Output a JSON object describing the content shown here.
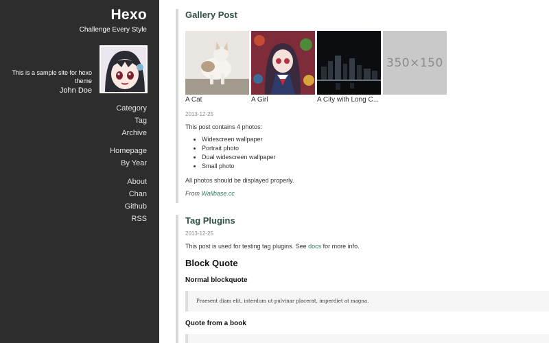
{
  "site": {
    "title": "Hexo",
    "subtitle": "Challenge Every Style",
    "description": "This is a sample site for hexo theme",
    "author": "John Doe"
  },
  "nav": {
    "group1": [
      "Category",
      "Tag",
      "Archive"
    ],
    "group2": [
      "Homepage",
      "By Year"
    ],
    "group3": [
      "About",
      "Chan",
      "Github",
      "RSS"
    ]
  },
  "posts": {
    "gallery": {
      "title": "Gallery Post",
      "images": [
        {
          "caption": "A Cat",
          "icon": "cat-photo"
        },
        {
          "caption": "A Girl",
          "icon": "anime-girl-photo"
        },
        {
          "caption": "A City with Long C...",
          "icon": "city-night-photo"
        },
        {
          "caption": "",
          "icon": "placeholder",
          "placeholder_text": "350×150"
        }
      ],
      "date": "2013-12-25",
      "intro": "This post contains 4 photos:",
      "list": [
        "Widescreen wallpaper",
        "Portrait photo",
        "Dual widescreen wallpaper",
        "Small photo"
      ],
      "note": "All photos should be displayed properly.",
      "from_prefix": "From",
      "from_link": "Wallbase.cc"
    },
    "tag": {
      "title": "Tag Plugins",
      "date": "2013-12-25",
      "text_before": "This post is used for testing tag plugins. See",
      "link": "docs",
      "text_after": "for more info.",
      "h2": "Block Quote",
      "h4_normal": "Normal blockquote",
      "quote_text": "Praesent diam elit, interdum ut pulvinar placerat, imperdiet at magna.",
      "h4_book": "Quote from a book"
    }
  },
  "colors": {
    "sidebar_bg": "#2d2d2d",
    "post_title": "#2f5144",
    "link": "#2f7a5a"
  }
}
